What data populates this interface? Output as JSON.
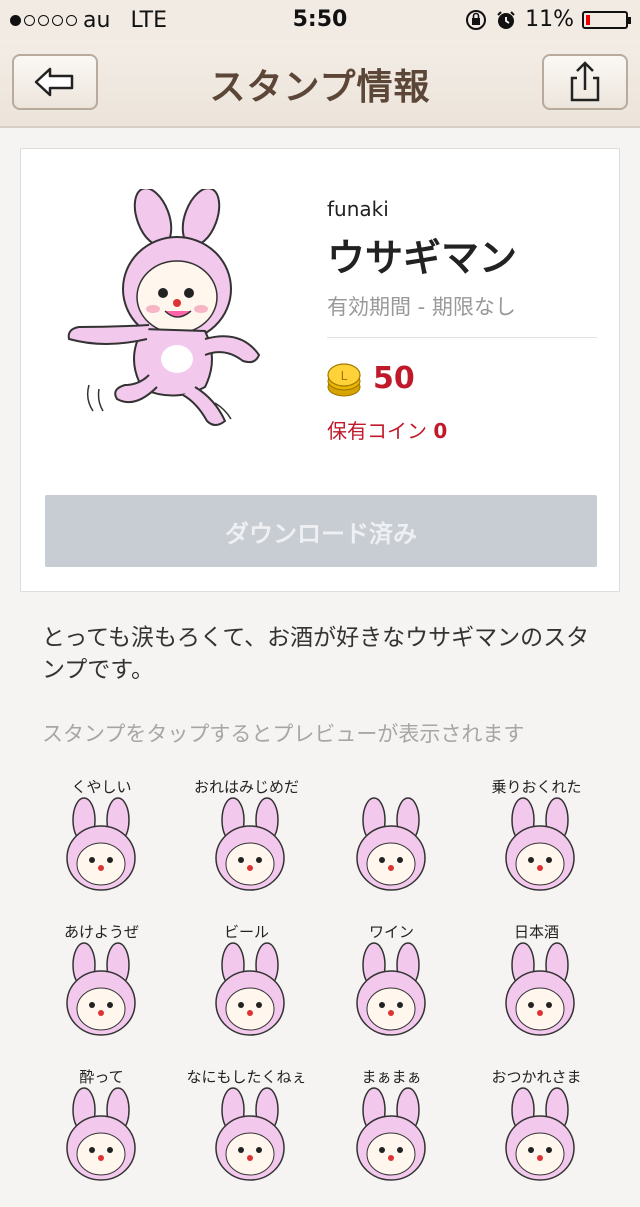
{
  "status_bar": {
    "carrier": "au",
    "network": "LTE",
    "time": "5:50",
    "battery": "11%",
    "battery_level": 0.11
  },
  "nav": {
    "title": "スタンプ情報"
  },
  "sticker_pack": {
    "author": "funaki",
    "name": "ウサギマン",
    "validity": "有効期間 - 期限なし",
    "price": "50",
    "owned_coins_label": "保有コイン",
    "owned_coins_value": "0",
    "download_label": "ダウンロード済み",
    "description": "とっても涙もろくて、お酒が好きなウサギマンのスタンプです。",
    "preview_hint": "スタンプをタップするとプレビューが表示されます"
  },
  "stickers": [
    {
      "caption": "くやしい"
    },
    {
      "caption": "おれはみじめだ"
    },
    {
      "caption": ""
    },
    {
      "caption": "乗りおくれた"
    },
    {
      "caption": "あけようぜ"
    },
    {
      "caption": "ビール"
    },
    {
      "caption": "ワイン"
    },
    {
      "caption": "日本酒"
    },
    {
      "caption": "酔って"
    },
    {
      "caption": "なにもしたくねぇ"
    },
    {
      "caption": "まぁまぁ"
    },
    {
      "caption": "おつかれさま"
    }
  ],
  "colors": {
    "nav_title": "#5b4637",
    "price_red": "#c01a2a",
    "rabbit_pink": "#f2c8ec",
    "download_disabled": "#c8ccd3"
  }
}
